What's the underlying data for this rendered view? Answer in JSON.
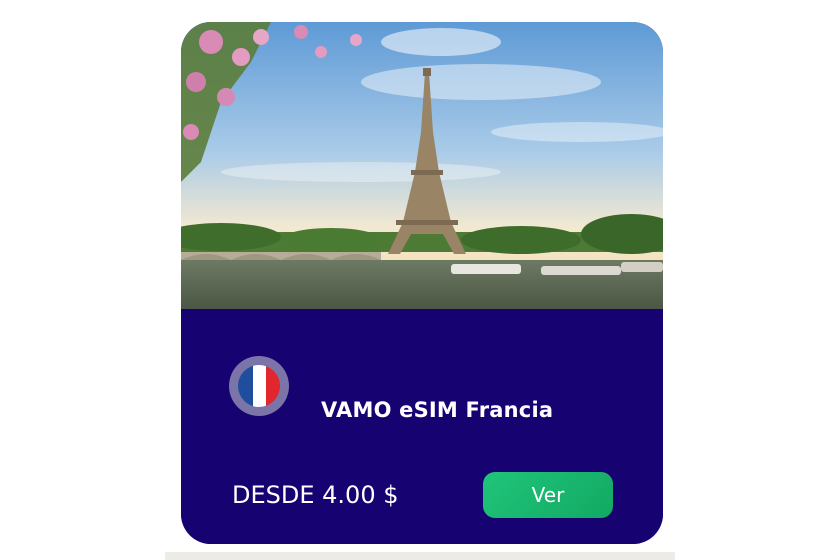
{
  "card": {
    "image": {
      "alt": "Eiffel Tower",
      "name": "eiffel-tower-photo"
    },
    "flag": {
      "icon": "france-flag-icon",
      "colors": [
        "#1f4e9e",
        "#ffffff",
        "#e1262d"
      ]
    },
    "title": "VAMO eSIM Francia",
    "price_label": "DESDE 4.00 $",
    "button_label": "Ver"
  },
  "colors": {
    "card_background": "#170272",
    "button": "#1db46e",
    "text": "#ffffff"
  }
}
